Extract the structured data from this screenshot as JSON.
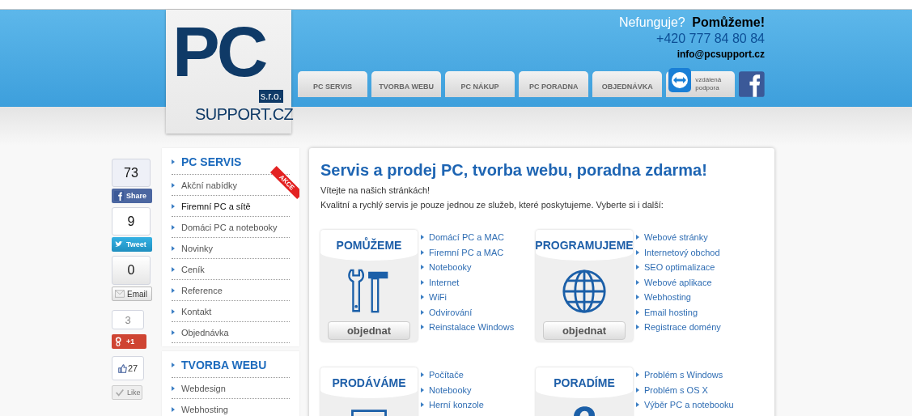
{
  "logo": {
    "mark": "PC",
    "suffix": "s.r.o.",
    "name": "SUPPORT.CZ"
  },
  "contact": {
    "tagline": "Nefunguje? **Pomůžeme!**",
    "phone": "+420 777 84 80 84",
    "email": "info@pcsupport.cz"
  },
  "tabs": [
    {
      "label": "PC SERVIS"
    },
    {
      "label": "TVORBA WEBU"
    },
    {
      "label": "PC NÁKUP"
    },
    {
      "label": "PC PORADNA"
    },
    {
      "label": "OBJEDNÁVKA"
    }
  ],
  "remote_support": {
    "label": "vzdálená podpora"
  },
  "social": [
    {
      "kind": "facebook",
      "count": "73",
      "label": "Share"
    },
    {
      "kind": "twitter",
      "count": "9",
      "label": "Tweet"
    },
    {
      "kind": "email",
      "count": "0",
      "label": "Email"
    },
    {
      "kind": "gplus",
      "count": "3",
      "label": "+1"
    },
    {
      "kind": "like",
      "count": "27",
      "label": "Like"
    }
  ],
  "sidebar": [
    {
      "title": "PC SERVIS",
      "items": [
        {
          "label": "Akční nabídky",
          "selected": false,
          "ribbon": "AKCE"
        },
        {
          "label": "Firemní PC a sítě",
          "selected": true
        },
        {
          "label": "Domáci PC a notebooky",
          "selected": false
        },
        {
          "label": "Novinky",
          "selected": false
        },
        {
          "label": "Ceník",
          "selected": false
        },
        {
          "label": "Reference",
          "selected": false
        },
        {
          "label": "Kontakt",
          "selected": false
        },
        {
          "label": "Objednávka",
          "selected": false
        }
      ]
    },
    {
      "title": "TVORBA WEBU",
      "items": [
        {
          "label": "Webdesign",
          "selected": false
        },
        {
          "label": "Webhosting",
          "selected": false
        }
      ]
    }
  ],
  "main": {
    "heading": "Servis a prodej PC, tvorba webu, poradna zdarma!",
    "intro": [
      "Vítejte na našich stránkách!",
      "Kvalitní a rychlý servis je pouze jednou ze služeb, které poskytujeme. Vyberte si i další:"
    ],
    "services": [
      {
        "title": "POMŮŽEME",
        "kind": "tools",
        "button": "objednat",
        "links": [
          "Domácí PC a MAC",
          "Firemní PC a MAC",
          "Notebooky",
          "Internet",
          "WiFi",
          "Odvirování",
          "Reinstalace Windows"
        ]
      },
      {
        "title": "PROGRAMUJEME",
        "kind": "globe",
        "button": "objednat",
        "links": [
          "Webové stránky",
          "Internetový obchod",
          "SEO optimalizace",
          "Webové aplikace",
          "Webhosting",
          "Email hosting",
          "Registrace domény"
        ]
      },
      {
        "title": "PRODÁVÁME",
        "kind": "monitor",
        "links": [
          "Počítače",
          "Notebooky",
          "Herní konzole"
        ]
      },
      {
        "title": "PORADÍME",
        "kind": "question",
        "links": [
          "Problém s Windows",
          "Problém s OS X",
          "Výběr PC a notebooku"
        ]
      }
    ]
  }
}
